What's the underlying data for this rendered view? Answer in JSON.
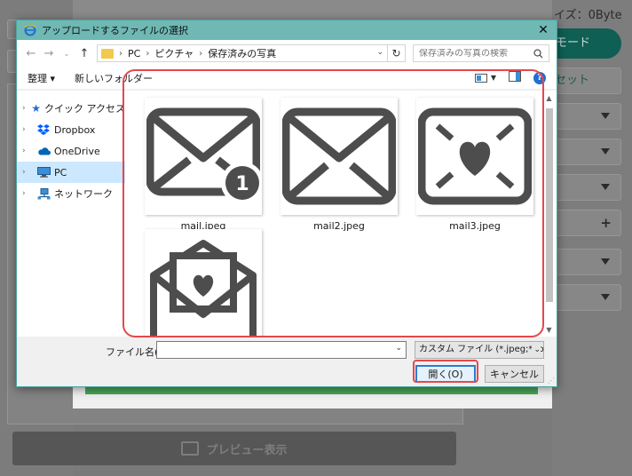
{
  "background": {
    "size_label": "イズ：0Byte",
    "mode_button": "モード",
    "reset_button": "セット",
    "preview_button": "プレビュー表示"
  },
  "dialog": {
    "title": "アップロードするファイルの選択",
    "close_glyph": "✕",
    "address": {
      "crumbs": [
        "PC",
        "ピクチャ",
        "保存済みの写真"
      ]
    },
    "search_placeholder": "保存済みの写真の検索",
    "toolbar": {
      "organize": "整理 ▾",
      "new_folder": "新しいフォルダー"
    },
    "nav_items": [
      {
        "label": "クイック アクセス",
        "icon": "star-icon"
      },
      {
        "label": "Dropbox",
        "icon": "dropbox-icon"
      },
      {
        "label": "OneDrive",
        "icon": "cloud-icon"
      },
      {
        "label": "PC",
        "icon": "pc-icon",
        "selected": true
      },
      {
        "label": "ネットワーク",
        "icon": "network-icon"
      }
    ],
    "files": [
      {
        "name": "mail.jpeg",
        "icon": "envelope-badge-1-icon"
      },
      {
        "name": "mail2.jpeg",
        "icon": "envelope-icon"
      },
      {
        "name": "mail3.jpeg",
        "icon": "envelope-heart-icon"
      },
      {
        "name": "",
        "icon": "open-envelope-heart-letter-icon"
      }
    ],
    "badge_number": "1",
    "footer": {
      "filename_label": "ファイル名(N):",
      "filename_value": "",
      "file_type": "カスタム ファイル (*.jpeg;*.jpg;*.jpe",
      "open_button": "開く(O)",
      "cancel_button": "キャンセル"
    }
  },
  "colors": {
    "titlebar": "#6fb8b4",
    "highlight": "#e5484d",
    "accent": "#2b7cd3"
  }
}
